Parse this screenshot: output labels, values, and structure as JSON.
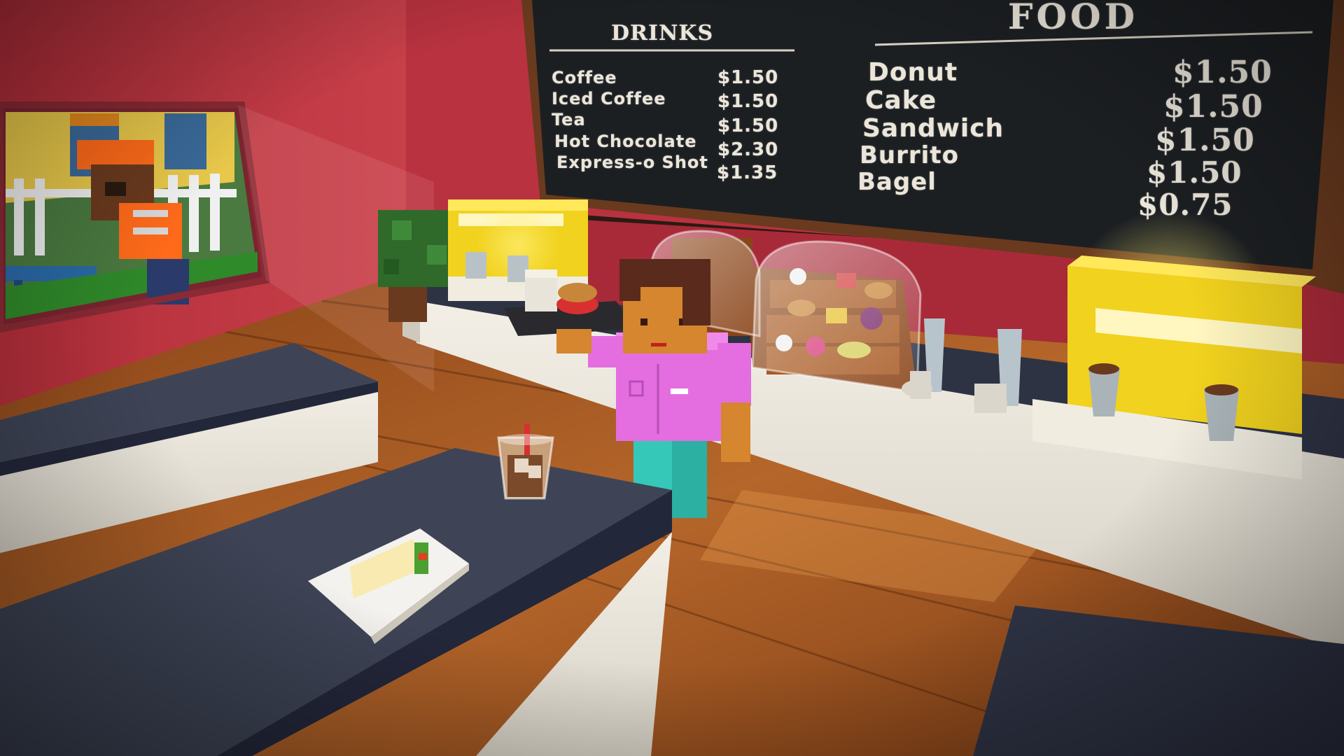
{
  "menu_board": {
    "drinks_heading": "DRINKS",
    "food_heading": "FOOD",
    "drinks": [
      {
        "name": "Coffee",
        "price": "$1.50"
      },
      {
        "name": "Iced Coffee",
        "price": "$1.50"
      },
      {
        "name": "Tea",
        "price": "$1.50"
      },
      {
        "name": "Hot Chocolate",
        "price": "$2.30"
      },
      {
        "name": "Express-o Shot",
        "price": "$1.35"
      }
    ],
    "food_names": [
      "Donut",
      "Cake",
      "Sandwich",
      "Burrito",
      "Bagel"
    ],
    "food_prices": [
      "$1.50",
      "$1.50",
      "$1.50",
      "$1.50",
      "$0.75"
    ]
  },
  "colors": {
    "wall_red": "#c23a44",
    "floor_wood": "#a85a22",
    "counter_top": "#3e4456",
    "chalkboard": "#1c1f22",
    "board_frame": "#6a3a1e",
    "coffee_machine_yellow": "#f1d21e",
    "barista_shirt": "#e46ee0",
    "barista_pants": "#35c8b8",
    "barista_hair": "#5a2a1c",
    "barista_skin": "#d5862e",
    "customer_vest": "#ff6a1a"
  },
  "scene_objects": {
    "characters": [
      "barista",
      "customer-outside-window"
    ],
    "items": [
      "iced-coffee-cup",
      "sandwich-plate",
      "pastry-display-case",
      "coffee-machine",
      "paper-cups",
      "serving-tray",
      "potted-plant"
    ]
  }
}
